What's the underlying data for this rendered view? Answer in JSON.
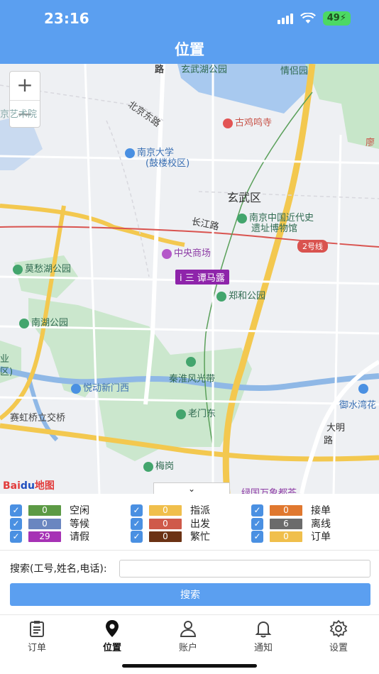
{
  "status_bar": {
    "time": "23:16",
    "battery": "49"
  },
  "nav": {
    "title": "位置"
  },
  "map": {
    "zoom_in": "+",
    "zoom_out": "−",
    "labels": {
      "lu_top": "路",
      "xuanwuhu": "玄武湖公园",
      "qingluyuan": "情侣园",
      "jiming_temple": "古鸡鸣寺",
      "nju": "南京大学",
      "nju_sub": "(鼓楼校区)",
      "beijing_road": "北京东路",
      "district": "玄武区",
      "changjiang_road": "长江路",
      "museum_1": "南京中国近代史",
      "museum_2": "遗址博物馆",
      "zhongyang_mall": "中央商场",
      "mochou_park": "莫愁湖公园",
      "zhenghe_park": "郑和公园",
      "nanhu_park": "南湖公园",
      "qinhuai_belt": "秦淮风光带",
      "yuedong": "悦动新门西",
      "laomendong": "老门东",
      "saihongqiao": "赛虹桥立交桥",
      "meigang": "梅岗",
      "ming_road_1": "大明",
      "ming_road_2": "路",
      "yushuiwan": "御水湾花",
      "wanxiang": "绿国万象都荟",
      "left_edge_1": "业",
      "left_edge_2": "区)",
      "top_left": "京艺术院",
      "mi": "廖"
    },
    "line_badge": "2号线",
    "worker_marker": "i 三 谭马露",
    "baidu_logo_1": "Bai",
    "baidu_logo_2": "du",
    "baidu_logo_3": "地图",
    "collapse_icon": "⌄"
  },
  "legend": {
    "items": [
      {
        "label": "空闲",
        "count": "0",
        "color": "#5c9a45"
      },
      {
        "label": "指派",
        "count": "0",
        "color": "#f0bf4c"
      },
      {
        "label": "接单",
        "count": "0",
        "color": "#e0782f"
      },
      {
        "label": "等候",
        "count": "0",
        "color": "#6a86c0"
      },
      {
        "label": "出发",
        "count": "0",
        "color": "#cf5a4a"
      },
      {
        "label": "离线",
        "count": "6",
        "color": "#6b6b6b"
      },
      {
        "label": "请假",
        "count": "29",
        "color": "#a632b5"
      },
      {
        "label": "繁忙",
        "count": "0",
        "color": "#6b3214"
      },
      {
        "label": "订单",
        "count": "0",
        "color": "#f0bf4c"
      }
    ],
    "check_mark": "✓"
  },
  "search": {
    "label": "搜索(工号,姓名,电话):",
    "value": "",
    "placeholder": "",
    "button": "搜索"
  },
  "tabbar": {
    "tabs": [
      {
        "label": "订单",
        "icon": "clipboard-icon"
      },
      {
        "label": "位置",
        "icon": "location-pin-icon"
      },
      {
        "label": "账户",
        "icon": "person-icon"
      },
      {
        "label": "通知",
        "icon": "bell-icon"
      },
      {
        "label": "设置",
        "icon": "gear-icon"
      }
    ],
    "active_index": 1
  },
  "colors": {
    "accent": "#5b9ff0"
  }
}
